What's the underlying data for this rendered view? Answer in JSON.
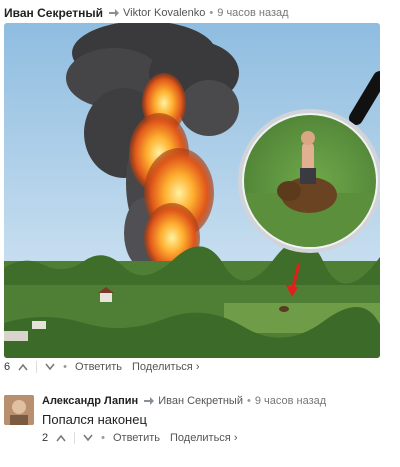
{
  "post": {
    "author": "Иван Секретный",
    "reply_to": "Viktor Kovalenko",
    "time": "9 часов назад",
    "votes": "6",
    "reply_label": "Ответить",
    "share_label": "Поделиться ›"
  },
  "comment": {
    "author": "Александр Лапин",
    "reply_to": "Иван Секретный",
    "time": "9 часов назад",
    "text": "Попался наконец",
    "votes": "2",
    "reply_label": "Ответить",
    "share_label": "Поделиться ›"
  },
  "icons": {
    "reply_arrow": "reply-arrow-icon",
    "upvote": "chevron-up-icon",
    "downvote": "chevron-down-icon"
  },
  "colors": {
    "text": "#222222",
    "muted": "#777777",
    "link": "#555555"
  }
}
